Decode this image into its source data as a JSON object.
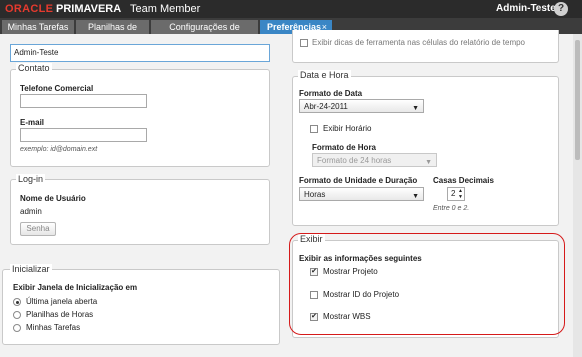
{
  "header": {
    "logo_oracle": "ORACLE",
    "logo_primavera": "PRIMAVERA",
    "logo_product": "Team Member",
    "user": "Admin-Teste",
    "user_caret": "▾",
    "help": "?"
  },
  "tabs": [
    {
      "label": "Minhas Tarefas"
    },
    {
      "label": "Planilhas de Horas"
    },
    {
      "label": "Configurações de Aplicativo"
    },
    {
      "label": "Preferências",
      "active": true,
      "close": "×"
    }
  ],
  "left": {
    "name_value": "Admin-Teste",
    "contact": {
      "legend": "Contato",
      "phone_label": "Telefone Comercial",
      "phone_value": "",
      "email_label": "E-mail",
      "email_value": "",
      "email_hint": "exemplo: id@domain.ext"
    },
    "login": {
      "legend": "Log-in",
      "username_label": "Nome de Usuário",
      "username_value": "admin",
      "password_button": "Senha"
    },
    "startup": {
      "legend": "Inicializar",
      "label": "Exibir Janela de Inicialização em",
      "options": [
        {
          "label": "Última janela aberta",
          "selected": true
        },
        {
          "label": "Planilhas de Horas",
          "selected": false
        },
        {
          "label": "Minhas Tarefas",
          "selected": false
        }
      ]
    }
  },
  "right": {
    "top_partial_text": "Exibir dicas de ferramenta nas células do relatório de tempo",
    "date_time": {
      "legend": "Data e Hora",
      "date_format_label": "Formato de Data",
      "date_format_value": "Abr-24-2011",
      "show_time_label": "Exibir Horário",
      "show_time_checked": false,
      "time_format_label": "Formato de Hora",
      "time_format_value": "Formato de 24 horas",
      "unit_format_label": "Formato de Unidade e Duração",
      "unit_format_value": "Horas",
      "decimals_label": "Casas Decimais",
      "decimals_value": "2",
      "decimals_hint": "Entre 0 e 2."
    },
    "display": {
      "legend": "Exibir",
      "label": "Exibir as informações seguintes",
      "options": [
        {
          "label": "Mostrar Projeto",
          "checked": true
        },
        {
          "label": "Mostrar ID do Projeto",
          "checked": false
        },
        {
          "label": "Mostrar WBS",
          "checked": true
        }
      ]
    }
  },
  "colors": {
    "oracle_red": "#e63a2e",
    "active_tab": "#3a86c5",
    "highlight": "#d51a1a"
  }
}
